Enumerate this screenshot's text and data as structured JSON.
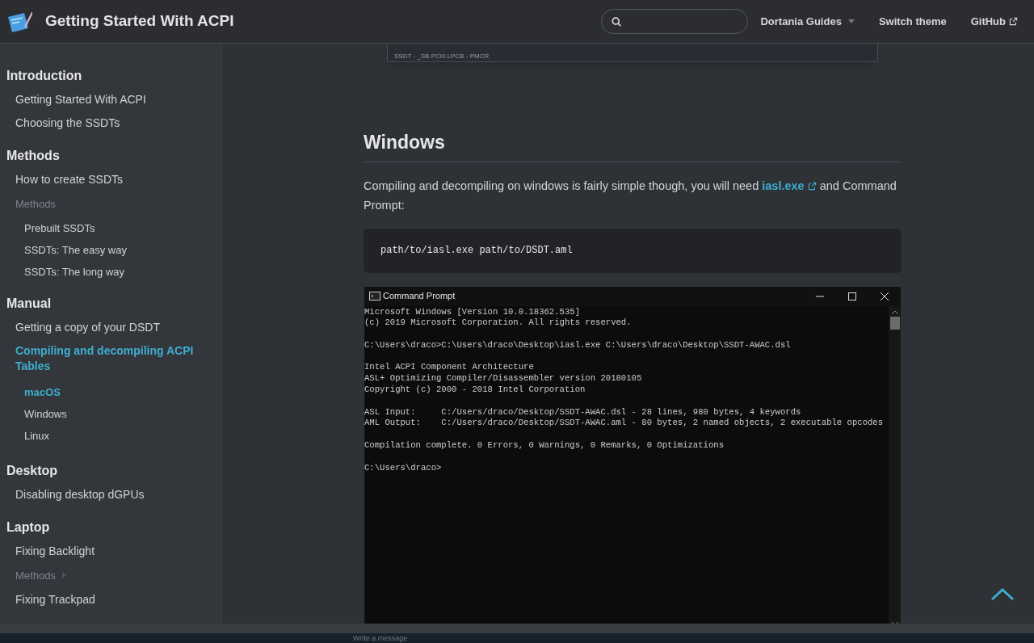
{
  "header": {
    "title": "Getting Started With ACPI",
    "nav": [
      {
        "label": "Dortania Guides",
        "kind": "dropdown"
      },
      {
        "label": "Switch theme",
        "kind": "link"
      },
      {
        "label": "GitHub",
        "kind": "external"
      }
    ]
  },
  "sidebar": {
    "sections": [
      {
        "title": "Introduction",
        "items": [
          {
            "label": "Getting Started With ACPI",
            "kind": "link",
            "selected": false
          },
          {
            "label": "Choosing the SSDTs",
            "kind": "link",
            "selected": false
          }
        ]
      },
      {
        "title": "Methods",
        "items": [
          {
            "label": "How to create SSDTs",
            "kind": "link",
            "selected": false
          },
          {
            "label": "Methods",
            "kind": "category",
            "expanded": true,
            "children": [
              {
                "label": "Prebuilt SSDTs",
                "kind": "link",
                "selected": false
              },
              {
                "label": "SSDTs: The easy way",
                "kind": "link",
                "selected": false
              },
              {
                "label": "SSDTs: The long way",
                "kind": "link",
                "selected": false
              }
            ]
          }
        ]
      },
      {
        "title": "Manual",
        "items": [
          {
            "label": "Getting a copy of your DSDT",
            "kind": "link",
            "selected": false
          },
          {
            "label": "Compiling and decompiling ACPI Tables",
            "kind": "link",
            "selected": true,
            "children": [
              {
                "label": "macOS",
                "kind": "link",
                "selected": true
              },
              {
                "label": "Windows",
                "kind": "link",
                "selected": false
              },
              {
                "label": "Linux",
                "kind": "link",
                "selected": false
              }
            ]
          }
        ]
      },
      {
        "title": "Desktop",
        "items": [
          {
            "label": "Disabling desktop dGPUs",
            "kind": "link",
            "selected": false
          }
        ]
      },
      {
        "title": "Laptop",
        "items": [
          {
            "label": "Fixing Backlight",
            "kind": "link",
            "selected": false
          },
          {
            "label": "Methods",
            "kind": "category",
            "expanded": false
          },
          {
            "label": "Fixing Trackpad",
            "kind": "link",
            "selected": false
          }
        ]
      }
    ]
  },
  "content": {
    "prev_image": {
      "status": "SSDT - _SB.PCI0.LPCB - PMCR"
    },
    "heading": "Windows",
    "paragraph": {
      "before": "Compiling and decompiling on windows is fairly simple though, you will need ",
      "link": "iasl.exe",
      "after": " and Command Prompt:"
    },
    "code": "path/to/iasl.exe path/to/DSDT.aml",
    "terminal": {
      "title": "Command Prompt",
      "blocks": [
        [
          "Microsoft Windows [Version 10.0.18362.535]",
          "(c) 2019 Microsoft Corporation. All rights reserved."
        ],
        [
          "C:\\Users\\draco>C:\\Users\\draco\\Desktop\\iasl.exe C:\\Users\\draco\\Desktop\\SSDT-AWAC.dsl"
        ],
        [
          "Intel ACPI Component Architecture",
          "ASL+ Optimizing Compiler/Disassembler version 20180105",
          "Copyright (c) 2000 - 2018 Intel Corporation"
        ],
        [
          "ASL Input:     C:/Users/draco/Desktop/SSDT-AWAC.dsl - 28 lines, 980 bytes, 4 keywords",
          "AML Output:    C:/Users/draco/Desktop/SSDT-AWAC.aml - 80 bytes, 2 named objects, 2 executable opcodes"
        ],
        [
          "Compilation complete. 0 Errors, 0 Warnings, 0 Remarks, 0 Optimizations"
        ],
        [
          "C:\\Users\\draco>"
        ]
      ]
    }
  },
  "taskbar": {
    "message_placeholder": "Write a message"
  }
}
